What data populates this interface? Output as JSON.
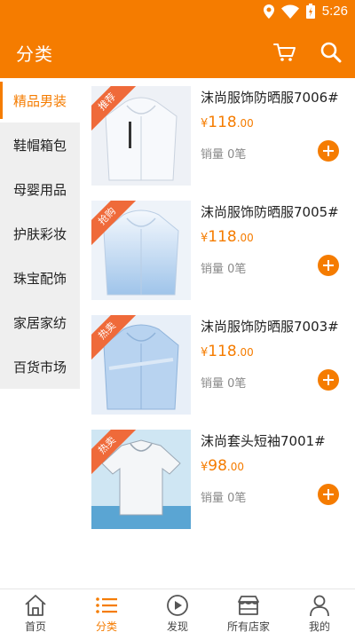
{
  "status": {
    "time": "5:26"
  },
  "header": {
    "title": "分类"
  },
  "categories": [
    {
      "label": "精品男装",
      "active": true
    },
    {
      "label": "鞋帽箱包"
    },
    {
      "label": "母婴用品"
    },
    {
      "label": "护肤彩妆"
    },
    {
      "label": "珠宝配饰"
    },
    {
      "label": "家居家纺"
    },
    {
      "label": "百货市场"
    }
  ],
  "products": [
    {
      "badge": "推荐",
      "name": "沫尚服饰防晒服7006#",
      "currency": "¥",
      "price_int": "118",
      "price_dec": ".00",
      "sales": "销量 0笔"
    },
    {
      "badge": "抢购",
      "name": "沫尚服饰防晒服7005#",
      "currency": "¥",
      "price_int": "118",
      "price_dec": ".00",
      "sales": "销量 0笔"
    },
    {
      "badge": "热卖",
      "name": "沫尚服饰防晒服7003#",
      "currency": "¥",
      "price_int": "118",
      "price_dec": ".00",
      "sales": "销量 0笔"
    },
    {
      "badge": "热卖",
      "name": "沫尚套头短袖7001#",
      "currency": "¥",
      "price_int": "98",
      "price_dec": ".00",
      "sales": "销量 0笔"
    }
  ],
  "tabs": [
    {
      "label": "首页",
      "icon": "home-icon"
    },
    {
      "label": "分类",
      "icon": "list-icon",
      "active": true
    },
    {
      "label": "发现",
      "icon": "play-icon"
    },
    {
      "label": "所有店家",
      "icon": "store-icon"
    },
    {
      "label": "我的",
      "icon": "person-icon"
    }
  ],
  "colors": {
    "accent": "#f57c00",
    "sidebar_bg": "#efefef",
    "badge": "#ef6a3a"
  }
}
